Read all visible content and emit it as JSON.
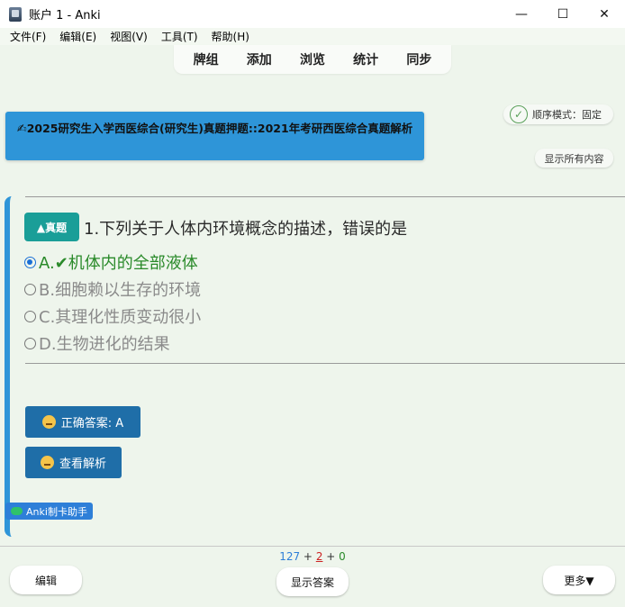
{
  "window": {
    "title": "账户 1 - Anki",
    "minimize": "—",
    "maximize": "☐",
    "close": "✕"
  },
  "menu": [
    "文件(F)",
    "编辑(E)",
    "视图(V)",
    "工具(T)",
    "帮助(H)"
  ],
  "toolbar": [
    "牌组",
    "添加",
    "浏览",
    "统计",
    "同步"
  ],
  "deck": {
    "icon": "✍",
    "title": "2025研究生入学西医综合(研究生)真题押题::2021年考研西医综合真题解析"
  },
  "order_mode": {
    "check": "✓",
    "label": "顺序模式：固定"
  },
  "show_all": "显示所有内容",
  "card": {
    "badge": "▲真题",
    "question": "1.下列关于人体内环境概念的描述，错误的是",
    "options": [
      {
        "text": "A.✔机体内的全部液体",
        "selected": true
      },
      {
        "text": "B.细胞赖以生存的环境",
        "selected": false
      },
      {
        "text": "C.其理化性质变动很小",
        "selected": false
      },
      {
        "text": "D.生物进化的结果",
        "selected": false
      }
    ],
    "answer_button": "正确答案: A",
    "analysis_button": "查看解析"
  },
  "helper_tag": "Anki制卡助手",
  "bottom": {
    "count_new": "127",
    "plus": "+",
    "count_learn": "2",
    "count_review": "0",
    "edit": "编辑",
    "show_answer": "显示答案",
    "more": "更多▼"
  },
  "colors": {
    "accent": "#2e95d8",
    "badge": "#1a9e98",
    "button": "#1f6ea8",
    "correct": "#2a8a2a",
    "background": "#eef5ec"
  }
}
